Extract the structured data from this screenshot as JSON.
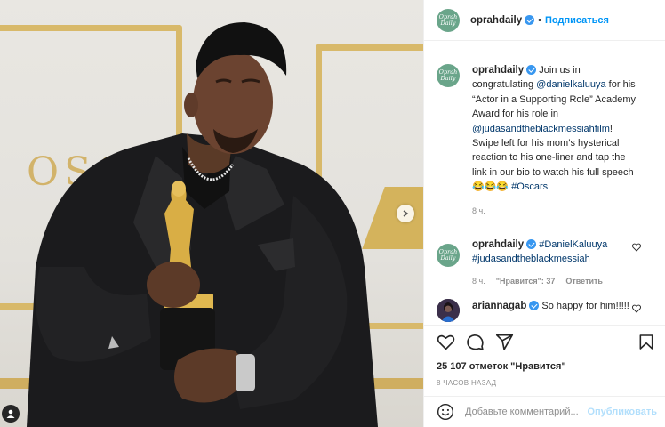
{
  "post": {
    "image_alt": "Man in black suit holding Oscar statuette",
    "backdrop_text": "OSCA"
  },
  "header": {
    "avatar_text": "Oprah Daily",
    "username": "oprahdaily",
    "separator": "•",
    "follow_label": "Подписаться"
  },
  "caption": {
    "username": "oprahdaily",
    "text_1": "Join us in congratulating ",
    "mention_1": "@danielkaluuya",
    "text_2": " for his “Actor in a Supporting Role” Academy Award for his role in ",
    "mention_2": "@judasandtheblackmessiahfilm",
    "text_3": "! Swipe left for his mom’s hysterical reaction to his one-liner and tap the link in our bio to watch his full speech 😂😂😂 ",
    "hashtag": "#Oscars",
    "time": "8 ч."
  },
  "comments": [
    {
      "username": "oprahdaily",
      "hashtag_1": "#DanielKaluuya",
      "hashtag_2": "#judasandtheblackmessiah",
      "time": "8 ч.",
      "likes": "\"Нравится\": 37",
      "reply": "Ответить"
    },
    {
      "username": "ariannagab",
      "text": "So happy for him!!!!!"
    }
  ],
  "actions": {
    "likes": "25 107 отметок \"Нравится\"",
    "time_ago": "8 ЧАСОВ НАЗАД"
  },
  "add_comment": {
    "placeholder": "Добавьте комментарий...",
    "publish": "Опубликовать"
  },
  "colors": {
    "accent": "#0095f6",
    "verified": "#3897f0",
    "brand_avatar": "#6aa58a",
    "gold": "#d4b35c"
  }
}
